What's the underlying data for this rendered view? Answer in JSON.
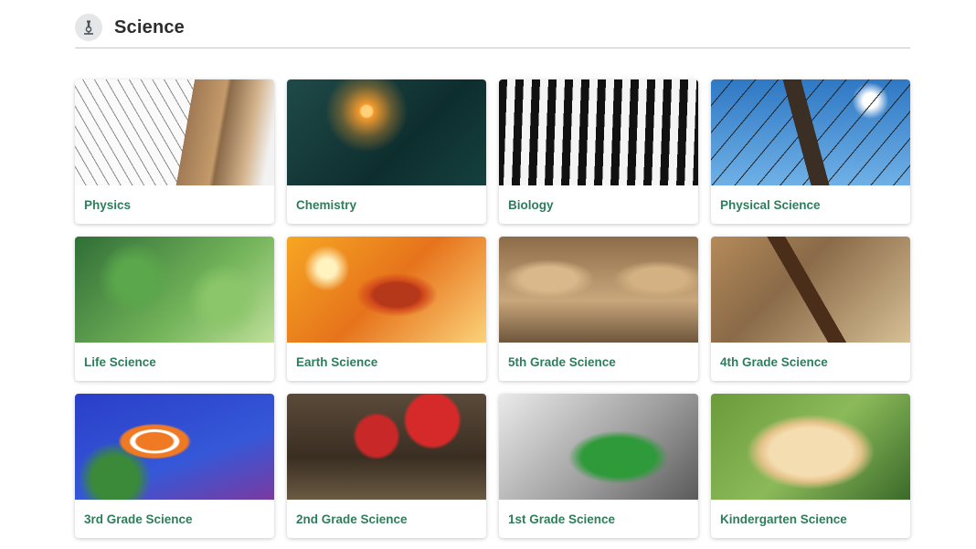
{
  "header": {
    "title": "Science",
    "icon": "microscope-icon"
  },
  "cards": [
    {
      "label": "Physics",
      "image": "brooklyn-bridge-cables"
    },
    {
      "label": "Chemistry",
      "image": "sparkler"
    },
    {
      "label": "Biology",
      "image": "zebra-stripes"
    },
    {
      "label": "Physical Science",
      "image": "power-lines-sky"
    },
    {
      "label": "Life Science",
      "image": "caterpillar-on-leaf"
    },
    {
      "label": "Earth Science",
      "image": "autumn-leaf"
    },
    {
      "label": "5th Grade Science",
      "image": "meerkats"
    },
    {
      "label": "4th Grade Science",
      "image": "insect-on-branch"
    },
    {
      "label": "3rd Grade Science",
      "image": "clownfish"
    },
    {
      "label": "2nd Grade Science",
      "image": "mushrooms"
    },
    {
      "label": "1st Grade Science",
      "image": "green-bird"
    },
    {
      "label": "Kindergarten Science",
      "image": "puppy-with-stick"
    }
  ],
  "colors": {
    "label": "#2e7d5b",
    "title": "#2d2d2d",
    "divider": "#c9c9c9"
  }
}
